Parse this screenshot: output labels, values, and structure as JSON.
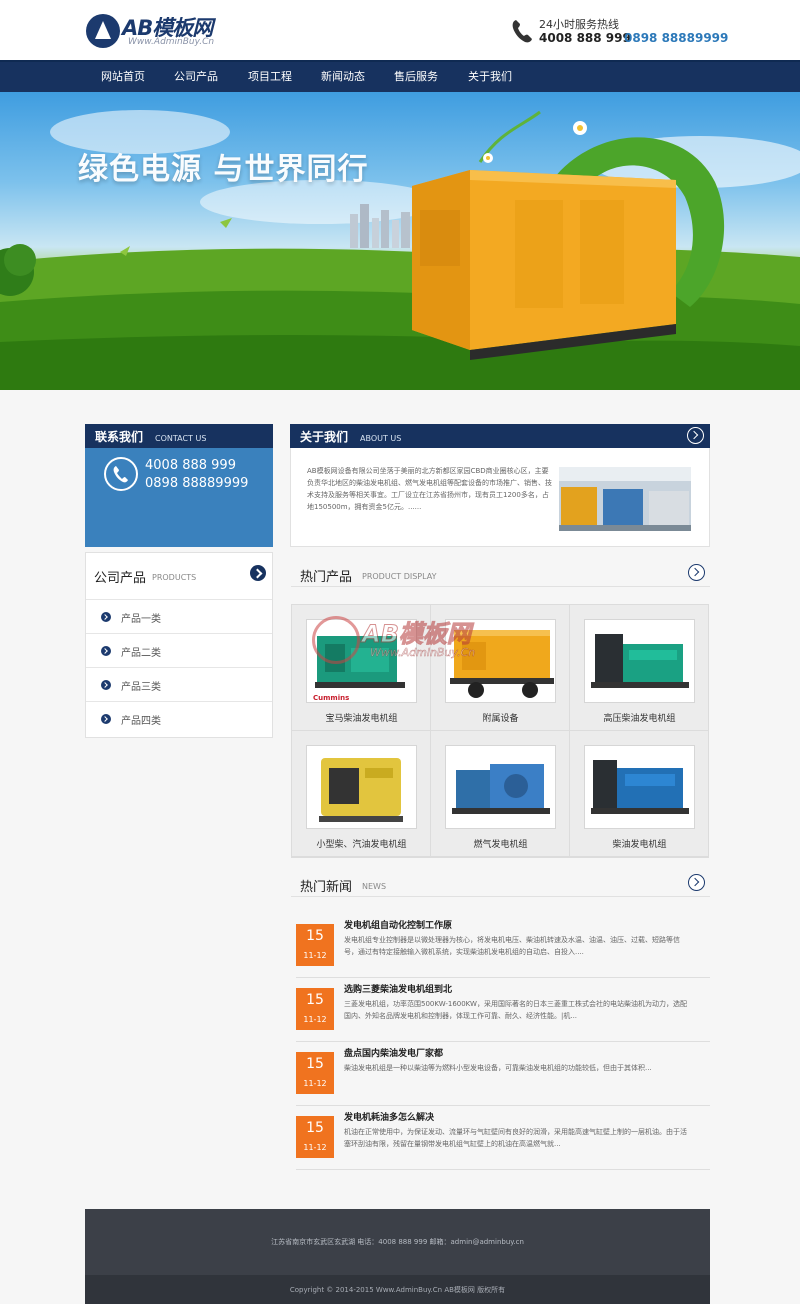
{
  "header": {
    "logo_text": "AB模板网",
    "logo_sub": "Www.AdminBuy.Cn",
    "hotline_label": "24小时服务热线",
    "hotline_num1": "4008 888 999",
    "hotline_num2": "0898 88889999"
  },
  "nav": [
    "网站首页",
    "公司产品",
    "项目工程",
    "新闻动态",
    "售后服务",
    "关于我们"
  ],
  "banner": {
    "title": "绿色电源 与世界同行"
  },
  "contact": {
    "title": "联系我们",
    "sub": "CONTACT US",
    "num1": "4008 888 999",
    "num2": "0898 88889999"
  },
  "products_menu": {
    "title": "公司产品",
    "sub": "PRODUCTS",
    "items": [
      "产品一类",
      "产品二类",
      "产品三类",
      "产品四类"
    ]
  },
  "about": {
    "title": "关于我们",
    "sub": "ABOUT US",
    "text": "AB模板网设备有限公司坐落于美丽的北方新都区家园CBD商业圈核心区，主要负责华北地区的柴油发电机组、燃气发电机组等配套设备的市场推广、销售、技术支持及服务等相关事宜。工厂设立在江苏省扬州市，现有员工1200多名，占地150500m，拥有资金5亿元。......"
  },
  "hot_products": {
    "title": "热门产品",
    "sub": "PRODUCT DISPLAY",
    "items": [
      {
        "label": "宝马柴油发电机组",
        "brand": "Cummins",
        "body_color": "#1b9a7d"
      },
      {
        "label": "附属设备",
        "brand": "",
        "body_color": "#f0a81c"
      },
      {
        "label": "高压柴油发电机组",
        "brand": "",
        "body_color": "#1aa183"
      },
      {
        "label": "小型柴、汽油发电机组",
        "brand": "",
        "body_color": "#e2c53e"
      },
      {
        "label": "燃气发电机组",
        "brand": "",
        "body_color": "#3b7fc6"
      },
      {
        "label": "柴油发电机组",
        "brand": "",
        "body_color": "#2270b5"
      }
    ]
  },
  "watermark": {
    "text": "AB模板网",
    "sub": "Www.AdminBuy.Cn"
  },
  "news": {
    "title": "热门新闻",
    "sub": "NEWS",
    "items": [
      {
        "day": "15",
        "md": "11-12",
        "title": "发电机组自动化控制工作原",
        "desc": "发电机组专业控制器是以微处理器为核心，将发电机电压、柴油机转速及水温、油温、油压、过载、短路等信号，通过有特定接触输入微机系统，实现柴油机发电机组的自动启、自投入...."
      },
      {
        "day": "15",
        "md": "11-12",
        "title": "选购三菱柴油发电机组到北",
        "desc": "三菱发电机组，功率范围500KW-1600KW，采用国际著名的日本三菱重工株式会社的电站柴油机为动力，选配国内、外知名品牌发电机和控制器，体现工作可靠、耐久、经济性能。|机..."
      },
      {
        "day": "15",
        "md": "11-12",
        "title": "盘点国内柴油发电厂家都",
        "desc": "柴油发电机组是一种以柴油等为燃料小型发电设备，可靠柴油发电机组的功能较低，但由于其体积..."
      },
      {
        "day": "15",
        "md": "11-12",
        "title": "发电机耗油多怎么解决",
        "desc": "机油在正常使用中，为保证发动、流量环与气缸壁间有良好的润滑，采用能高速气缸壁上制的一层机油。由于活塞环刮油有限，残留在量钢带发电机组气缸壁上的机油在高温燃气就..."
      }
    ]
  },
  "footer": {
    "info": "江苏省南京市玄武区玄武湖    电话：4008 888 999    邮箱：admin@adminbuy.cn",
    "copy": "Copyright © 2014-2015 Www.AdminBuy.Cn AB模板网 版权所有"
  },
  "colors": {
    "nav_bg": "#17325f",
    "accent_blue": "#3a81bd",
    "date_orange": "#f0731f",
    "footer_bg": "#3c4048"
  }
}
